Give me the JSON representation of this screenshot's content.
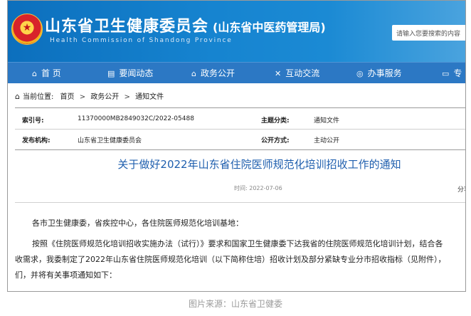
{
  "header": {
    "emblem_glyph": "★",
    "title": "山东省卫生健康委员会",
    "subtitle": "(山东省中医药管理局)",
    "english": "Health Commission  of  Shandong  Province",
    "search_placeholder": "请输入您要搜索的内容"
  },
  "nav": {
    "items": [
      {
        "icon": "home-icon",
        "glyph": "⌂",
        "label": "首 页"
      },
      {
        "icon": "news-icon",
        "glyph": "▤",
        "label": "要闻动态"
      },
      {
        "icon": "affairs-icon",
        "glyph": "⌂",
        "label": "政务公开"
      },
      {
        "icon": "interaction-icon",
        "glyph": "✕",
        "label": "互动交流"
      },
      {
        "icon": "service-icon",
        "glyph": "◎",
        "label": "办事服务"
      },
      {
        "icon": "topic-icon",
        "glyph": "▭",
        "label": "专"
      }
    ]
  },
  "breadcrumb": {
    "label": "当前位置:",
    "items": [
      "首页",
      "政务公开",
      "通知文件"
    ],
    "separator": ">"
  },
  "meta": {
    "index_label": "索引号:",
    "index_value": "11370000MB2849032C/2022-05488",
    "topic_label": "主题分类:",
    "topic_value": "通知文件",
    "issuer_label": "发布机构:",
    "issuer_value": "山东省卫生健康委员会",
    "mode_label": "公开方式:",
    "mode_value": "主动公开"
  },
  "article": {
    "title": "关于做好2022年山东省住院医师规范化培训招收工作的通知",
    "time": "时间:  2022-07-06",
    "share": "分享",
    "paragraphs": [
      "各市卫生健康委，省疾控中心，各住院医师规范化培训基地：",
      "按照《住院医师规范化培训招收实施办法（试行）》要求和国家卫生健康委下达我省的住院医师规范化培训计划，结合各",
      "收需求，我委制定了2022年山东省住院医师规范化培训（以下简称住培）招收计划及部分紧缺专业分市招收指标（见附件），",
      "们，并将有关事项通知如下："
    ]
  },
  "caption": "图片来源：山东省卫健委"
}
